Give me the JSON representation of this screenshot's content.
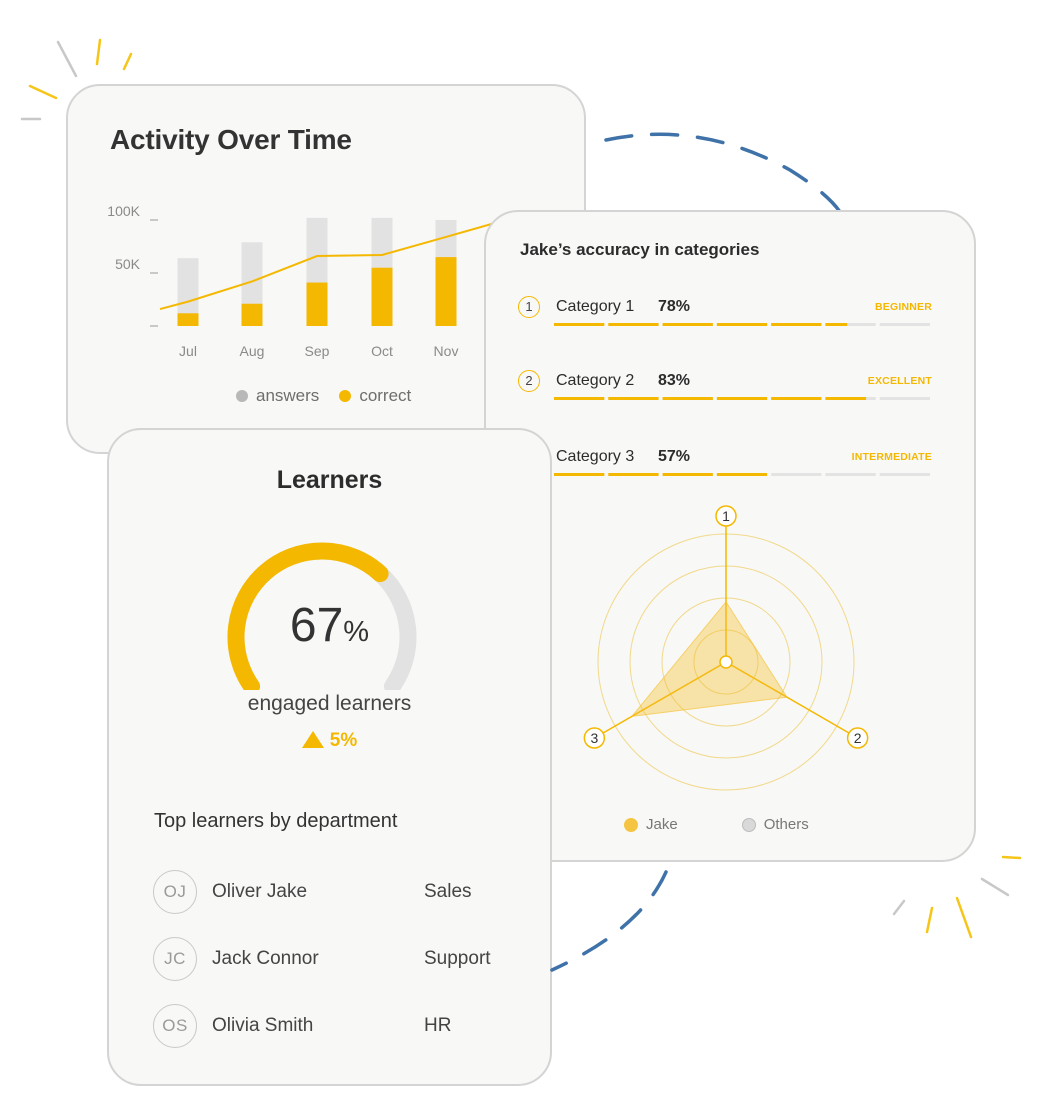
{
  "colors": {
    "accent": "#f5b800",
    "muted_bar": "#e2e2e2",
    "card_bg": "#f8f8f7",
    "card_border": "#d4d4d4",
    "dashed_line": "#3f72a8"
  },
  "activity": {
    "title": "Activity Over Time",
    "legend": [
      {
        "name": "answers",
        "color": "#b8b8b8"
      },
      {
        "name": "correct",
        "color": "#f5b800"
      }
    ],
    "chart_data": {
      "type": "bar",
      "categories": [
        "Jul",
        "Aug",
        "Sep",
        "Oct",
        "Nov"
      ],
      "series": [
        {
          "name": "answers",
          "type": "bar",
          "values": [
            64000,
            79000,
            102000,
            102000,
            100000
          ]
        },
        {
          "name": "correct",
          "type": "bar",
          "values": [
            12000,
            21000,
            41000,
            55000,
            65000
          ]
        },
        {
          "name": "trend",
          "type": "line",
          "values": [
            23000,
            42000,
            66000,
            67000,
            84000
          ]
        }
      ],
      "y_ticks": [
        "100K",
        "50K",
        ""
      ],
      "ylim": [
        0,
        100000
      ],
      "grid": false
    }
  },
  "accuracy": {
    "title": "Jake’s accuracy in categories",
    "categories": [
      {
        "num": "1",
        "label": "Category 1",
        "pct": "78%",
        "value": 78,
        "level": "BEGINNER"
      },
      {
        "num": "2",
        "label": "Category 2",
        "pct": "83%",
        "value": 83,
        "level": "EXCELLENT"
      },
      {
        "num": "3",
        "label": "Category 3",
        "pct": "57%",
        "value": 57,
        "level": "INTERMEDIATE"
      }
    ],
    "radar_axes": [
      "1",
      "2",
      "3"
    ],
    "radar_values_jake": [
      0.47,
      0.55,
      0.85
    ],
    "legend": [
      {
        "name": "Jake",
        "color": "#f5c542"
      },
      {
        "name": "Others",
        "color": "#d9d9d9"
      }
    ]
  },
  "learners": {
    "title": "Learners",
    "engaged_value": "67",
    "engaged_unit": "%",
    "engaged_fraction": 0.67,
    "caption": "engaged learners",
    "change": "5%",
    "top_title": "Top learners by department",
    "people": [
      {
        "initials": "OJ",
        "name": "Oliver Jake",
        "dept": "Sales"
      },
      {
        "initials": "JC",
        "name": "Jack Connor",
        "dept": "Support"
      },
      {
        "initials": "OS",
        "name": "Olivia Smith",
        "dept": "HR"
      }
    ]
  }
}
